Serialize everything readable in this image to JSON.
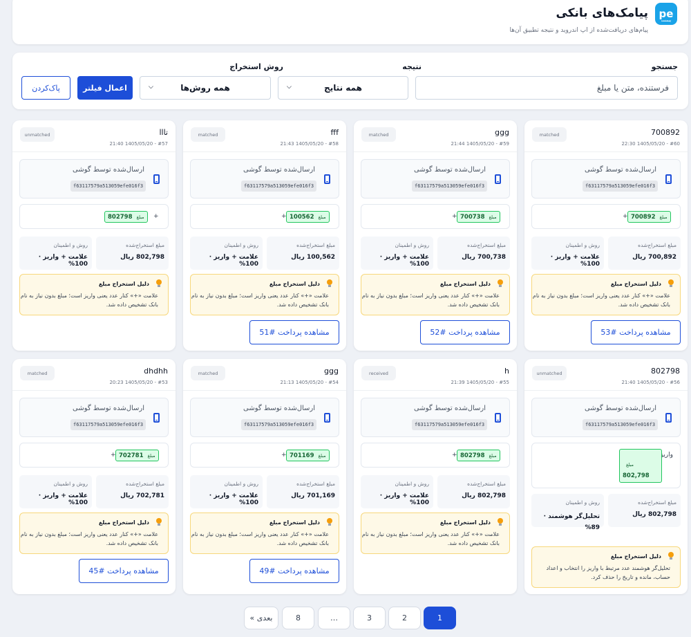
{
  "header": {
    "logo_text": "pe",
    "logo_subtext": "پیمنت",
    "title": "پیامک‌های بانکی",
    "subtitle": "پیام‌های دریافت‌شده از اپ اندروید و نتیجه تطبیق آن‌ها"
  },
  "filters": {
    "search_label": "جستجو",
    "search_placeholder": "فرستنده، متن یا مبلغ",
    "result_label": "نتیجه",
    "result_value": "همه نتایج",
    "method_label": "روش استخراج",
    "method_value": "همه روش‌ها",
    "apply_label": "اعمال فیلتر",
    "clear_label": "پاک‌کردن"
  },
  "labels": {
    "sent_by_phone": "ارسال‌شده توسط گوشی",
    "amount_tag": "مبلغ",
    "extracted_amount": "مبلغ استخراج‌شده",
    "method_confidence": "روش و اطمینان",
    "reason_title": "دلیل استخراج مبلغ"
  },
  "cards": [
    {
      "sender": "700892",
      "meta": "#60 - 1405/05/20 22:30",
      "status": "matched",
      "hash": "f63117579a513059efe016f3",
      "highlight": "700892",
      "plus": "+",
      "amount": "700,892 ریال",
      "method": "علامت + واریز · 100%",
      "reason": "علامت «+» کنار عدد یعنی واریز است؛ مبلغ بدون نیاز به نام بانک تشخیص داده شد.",
      "view": "مشاهده پرداخت #53"
    },
    {
      "sender": "ggg",
      "meta": "#59 - 1405/05/20 21:44",
      "status": "matched",
      "hash": "f63117579a513059efe016f3",
      "highlight": "700738",
      "plus": "+",
      "amount": "700,738 ریال",
      "method": "علامت + واریز · 100%",
      "reason": "علامت «+» کنار عدد یعنی واریز است؛ مبلغ بدون نیاز به نام بانک تشخیص داده شد.",
      "view": "مشاهده پرداخت #52"
    },
    {
      "sender": "fff",
      "meta": "#58 - 1405/05/20 21:43",
      "status": "matched",
      "hash": "f63117579a513059efe016f3",
      "highlight": "100562",
      "plus": "+",
      "amount": "100,562 ریال",
      "method": "علامت + واریز · 100%",
      "reason": "علامت «+» کنار عدد یعنی واریز است؛ مبلغ بدون نیاز به نام بانک تشخیص داده شد.",
      "view": "مشاهده پرداخت #51"
    },
    {
      "sender": "تااا",
      "meta": "#57 - 1405/05/20 21:40",
      "status": "unmatched",
      "hash": "f63117579a513059efe016f3",
      "highlight": "802798",
      "plus": "+",
      "amount": "802,798 ریال",
      "method": "علامت + واریز · 100%",
      "reason": "علامت «+» کنار عدد یعنی واریز است؛ مبلغ بدون نیاز به نام بانک تشخیص داده شد.",
      "view": ""
    },
    {
      "sender": "802798",
      "meta": "#56 - 1405/05/20 21:40",
      "status": "unmatched",
      "hash": "f63117579a513059efe016f3",
      "body_text": "واریز",
      "highlight": "802,798",
      "amount": "802,798 ریال",
      "method": "تحلیل‌گر هوشمند · 89%",
      "reason": "تحلیل‌گر هوشمند عدد مرتبط با واریز را انتخاب و اعداد حساب، مانده و تاریخ را حذف کرد.",
      "view": ""
    },
    {
      "sender": "h",
      "meta": "#55 - 1405/05/20 21:39",
      "status": "received",
      "hash": "f63117579a513059efe016f3",
      "highlight": "802798",
      "plus": "+",
      "amount": "802,798 ریال",
      "method": "علامت + واریز · 100%",
      "reason": "علامت «+» کنار عدد یعنی واریز است؛ مبلغ بدون نیاز به نام بانک تشخیص داده شد.",
      "view": ""
    },
    {
      "sender": "ggg",
      "meta": "#54 - 1405/05/20 21:13",
      "status": "matched",
      "hash": "f63117579a513059efe016f3",
      "highlight": "701169",
      "plus": "+",
      "amount": "701,169 ریال",
      "method": "علامت + واریز · 100%",
      "reason": "علامت «+» کنار عدد یعنی واریز است؛ مبلغ بدون نیاز به نام بانک تشخیص داده شد.",
      "view": "مشاهده پرداخت #49"
    },
    {
      "sender": "dhdhh",
      "meta": "#53 - 1405/05/20 20:23",
      "status": "matched",
      "hash": "f63117579a513059efe016f3",
      "highlight": "702781",
      "plus": "+",
      "amount": "702,781 ریال",
      "method": "علامت + واریز · 100%",
      "reason": "علامت «+» کنار عدد یعنی واریز است؛ مبلغ بدون نیاز به نام بانک تشخیص داده شد.",
      "view": "مشاهده پرداخت #45"
    }
  ],
  "pagination": {
    "pages": [
      "1",
      "2",
      "3",
      "…",
      "8"
    ],
    "next": "بعدی »",
    "active": "1"
  }
}
